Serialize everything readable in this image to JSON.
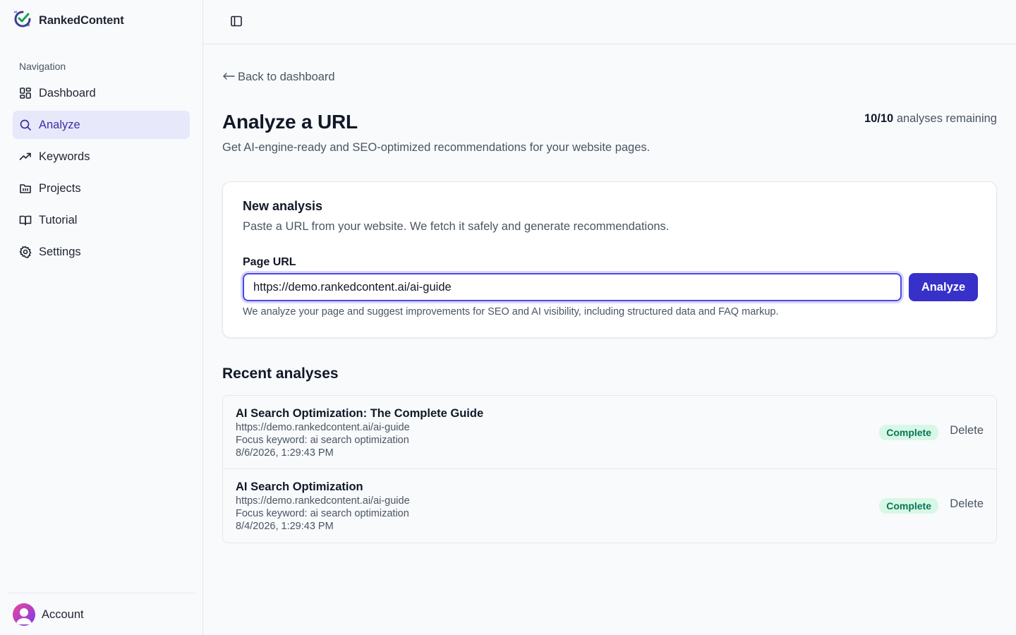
{
  "brand": {
    "name": "RankedContent"
  },
  "sidebar": {
    "heading": "Navigation",
    "items": [
      {
        "label": "Dashboard",
        "icon": "dashboard-icon"
      },
      {
        "label": "Analyze",
        "icon": "search-icon",
        "active": true
      },
      {
        "label": "Keywords",
        "icon": "trending-icon"
      },
      {
        "label": "Projects",
        "icon": "folder-icon"
      },
      {
        "label": "Tutorial",
        "icon": "book-icon"
      },
      {
        "label": "Settings",
        "icon": "gear-icon"
      }
    ],
    "account_label": "Account"
  },
  "main": {
    "back_link": "Back to dashboard",
    "title": "Analyze a URL",
    "subtitle": "Get AI-engine-ready and SEO-optimized recommendations for your website pages.",
    "remaining": {
      "count": "10/10",
      "label": "analyses remaining"
    }
  },
  "new_analysis": {
    "title": "New analysis",
    "description": "Paste a URL from your website. We fetch it safely and generate recommendations.",
    "field_label": "Page URL",
    "url_value": "https://demo.rankedcontent.ai/ai-guide",
    "button_label": "Analyze",
    "helper": "We analyze your page and suggest improvements for SEO and AI visibility, including structured data and FAQ markup."
  },
  "recent": {
    "title": "Recent analyses",
    "items": [
      {
        "title": "AI Search Optimization: The Complete Guide",
        "url": "https://demo.rankedcontent.ai/ai-guide",
        "keyword": "Focus keyword: ai search optimization",
        "date": "8/6/2026, 1:29:43 PM",
        "status": "Complete",
        "delete_label": "Delete"
      },
      {
        "title": "AI Search Optimization",
        "url": "https://demo.rankedcontent.ai/ai-guide",
        "keyword": "Focus keyword: ai search optimization",
        "date": "8/4/2026, 1:29:43 PM",
        "status": "Complete",
        "delete_label": "Delete"
      }
    ]
  },
  "colors": {
    "accent": "#3730c9",
    "active_nav_bg": "#e8e8fb",
    "success_bg": "#d9f7e6",
    "success_text": "#047857"
  }
}
